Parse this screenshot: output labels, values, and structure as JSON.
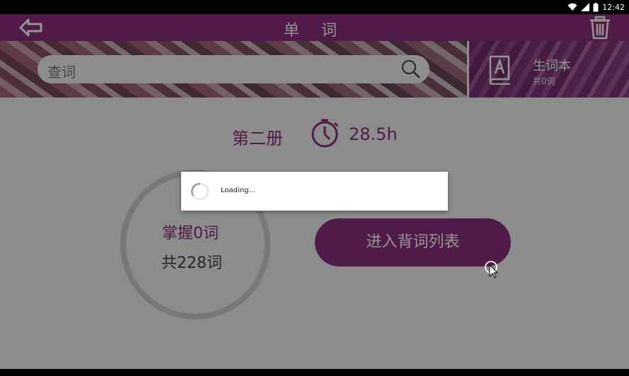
{
  "status": {
    "time": "12:42"
  },
  "header": {
    "title": "单 词"
  },
  "search": {
    "placeholder": "查词"
  },
  "wordbook": {
    "title": "生词本",
    "count": "共0词"
  },
  "book": {
    "name": "第二册",
    "hours": "28.5h"
  },
  "progress": {
    "mastered": "掌握0词",
    "total": "共228词"
  },
  "actions": {
    "enter_list": "进入背词列表"
  },
  "dialog": {
    "loading": "Loading..."
  },
  "colors": {
    "accent": "#8a2f7d",
    "background": "#f2f2f2",
    "ring": "#cfcfcf"
  },
  "icons": [
    "back-arrow-icon",
    "trash-icon",
    "search-icon",
    "book-a-icon",
    "timer-icon",
    "spinner-icon",
    "wifi-icon",
    "signal-icon",
    "battery-icon",
    "cursor-icon"
  ]
}
